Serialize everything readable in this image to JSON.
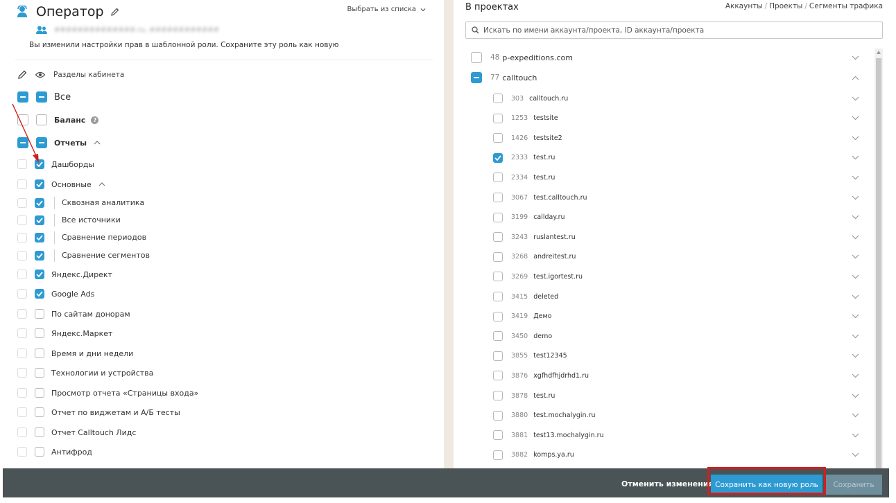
{
  "role": {
    "title": "Оператор",
    "pick_list": "Выбрать из списка",
    "user_email_blurred": "##############.ru, ############",
    "notice": "Вы изменили настройки прав в шаблонной роли. Сохраните эту роль как новую"
  },
  "sections": {
    "header": "Разделы кабинета",
    "items": [
      {
        "label": "Все",
        "edit": "indeterminate",
        "view": "indeterminate",
        "style": "big"
      },
      {
        "label": "Баланс",
        "edit": "empty",
        "view": "empty",
        "style": "bold",
        "help": "?"
      },
      {
        "label": "Отчеты",
        "edit": "indeterminate",
        "view": "indeterminate",
        "style": "bold",
        "expanded": true
      },
      {
        "label": "Дашборды",
        "edit": "faint",
        "view": "checked"
      },
      {
        "label": "Основные",
        "edit": "faint",
        "view": "checked",
        "expanded": true
      },
      {
        "label": "Сквозная аналитика",
        "edit": "faint",
        "view": "checked",
        "sub": true
      },
      {
        "label": "Все источники",
        "edit": "faint",
        "view": "checked",
        "sub": true
      },
      {
        "label": "Сравнение периодов",
        "edit": "faint",
        "view": "checked",
        "sub": true
      },
      {
        "label": "Сравнение сегментов",
        "edit": "faint",
        "view": "checked",
        "sub": true
      },
      {
        "label": "Яндекс.Директ",
        "edit": "faint",
        "view": "checked"
      },
      {
        "label": "Google Ads",
        "edit": "faint",
        "view": "checked"
      },
      {
        "label": "По сайтам донорам",
        "edit": "faint",
        "view": "empty"
      },
      {
        "label": "Яндекс.Маркет",
        "edit": "faint",
        "view": "empty"
      },
      {
        "label": "Время и дни недели",
        "edit": "faint",
        "view": "empty"
      },
      {
        "label": "Технологии и устройства",
        "edit": "faint",
        "view": "empty"
      },
      {
        "label": "Просмотр отчета «Страницы входа»",
        "edit": "faint",
        "view": "empty"
      },
      {
        "label": "Отчет по виджетам и А/Б тесты",
        "edit": "faint",
        "view": "empty"
      },
      {
        "label": "Отчет Calltouch Лидс",
        "edit": "faint",
        "view": "empty"
      },
      {
        "label": "Антифрод",
        "edit": "faint",
        "view": "empty"
      }
    ]
  },
  "projects": {
    "title": "В проектах",
    "crumbs": [
      "Аккаунты",
      "Проекты",
      "Сегменты трафика"
    ],
    "search_placeholder": "Искать по имени аккаунта/проекта, ID аккаунта/проекта",
    "accounts": [
      {
        "id": "48",
        "name": "p-expeditions.com",
        "state": "empty",
        "expanded": false
      },
      {
        "id": "77",
        "name": "calltouch",
        "state": "indeterminate",
        "expanded": true
      }
    ],
    "items": [
      {
        "id": "303",
        "name": "calltouch.ru",
        "checked": false
      },
      {
        "id": "1253",
        "name": "testsite",
        "checked": false
      },
      {
        "id": "1426",
        "name": "testsite2",
        "checked": false
      },
      {
        "id": "2333",
        "name": "test.ru",
        "checked": true
      },
      {
        "id": "2334",
        "name": "test.ru",
        "checked": false
      },
      {
        "id": "3067",
        "name": "test.calltouch.ru",
        "checked": false
      },
      {
        "id": "3199",
        "name": "callday.ru",
        "checked": false
      },
      {
        "id": "3243",
        "name": "ruslantest.ru",
        "checked": false
      },
      {
        "id": "3268",
        "name": "andreitest.ru",
        "checked": false
      },
      {
        "id": "3269",
        "name": "test.igortest.ru",
        "checked": false
      },
      {
        "id": "3415",
        "name": "deleted",
        "checked": false
      },
      {
        "id": "3419",
        "name": "Демо",
        "checked": false
      },
      {
        "id": "3450",
        "name": "demo",
        "checked": false
      },
      {
        "id": "3855",
        "name": "test12345",
        "checked": false
      },
      {
        "id": "3876",
        "name": "xgfhdfhjdrhd1.ru",
        "checked": false
      },
      {
        "id": "3878",
        "name": "test.ru",
        "checked": false
      },
      {
        "id": "3880",
        "name": "test.mochalygin.ru",
        "checked": false
      },
      {
        "id": "3881",
        "name": "test13.mochalygin.ru",
        "checked": false
      },
      {
        "id": "3882",
        "name": "komps.ya.ru",
        "checked": false
      }
    ]
  },
  "footer": {
    "cancel": "Отменить изменения",
    "save_new": "Сохранить как новую роль",
    "save": "Сохранить"
  },
  "colors": {
    "accent": "#2d9bd2",
    "footer_bg": "#4a5457",
    "highlight": "#d21e1e",
    "divider": "#efe9e2"
  }
}
